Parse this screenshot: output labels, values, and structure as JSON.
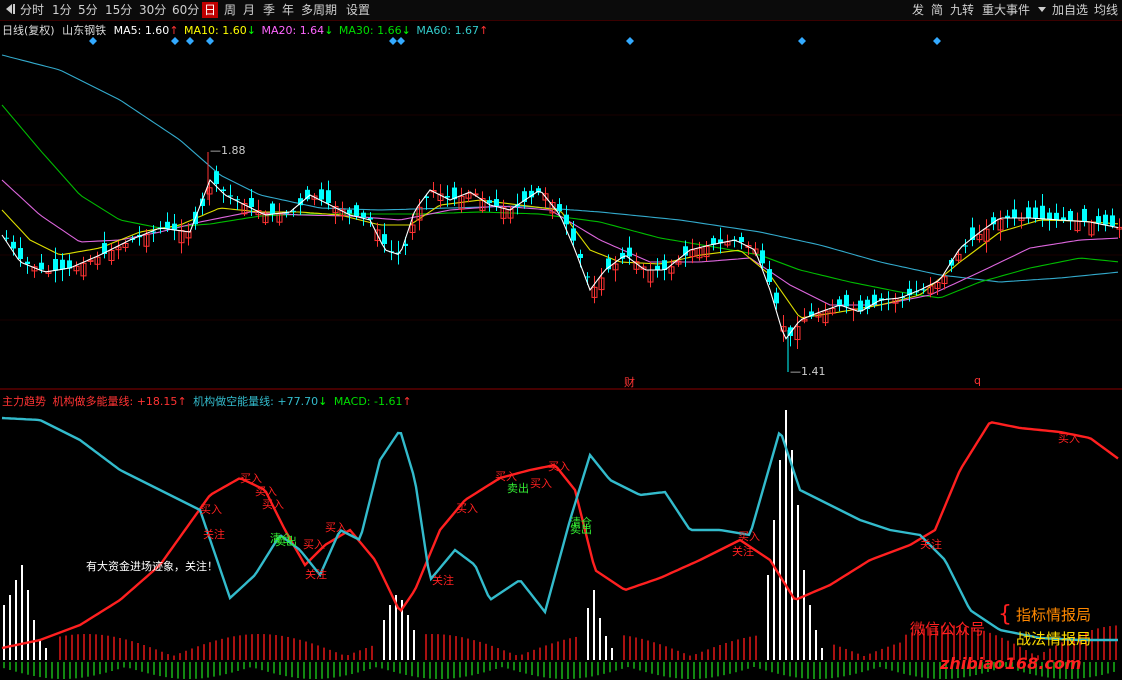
{
  "toolbar": {
    "back_icon": "back-arrow-icon",
    "periods": [
      "分时",
      "1分",
      "5分",
      "15分",
      "30分",
      "60分",
      "日",
      "周",
      "月",
      "季",
      "年",
      "多周期",
      "设置"
    ],
    "active_period": "日",
    "right_buttons": [
      "发",
      "简",
      "九转",
      "重大事件",
      "加自选",
      "均线"
    ]
  },
  "price_panel": {
    "chart_label": "日线(复权)",
    "stock_name": "山东钢铁",
    "ma": [
      {
        "name": "MA5",
        "value": "1.60",
        "arrow": "↑",
        "color": "#ffffff"
      },
      {
        "name": "MA10",
        "value": "1.60",
        "arrow": "↓",
        "color": "#ffff00"
      },
      {
        "name": "MA20",
        "value": "1.64",
        "arrow": "↓",
        "color": "#ff66ff"
      },
      {
        "name": "MA30",
        "value": "1.66",
        "arrow": "↓",
        "color": "#00dd00"
      },
      {
        "name": "MA60",
        "value": "1.67",
        "arrow": "↑",
        "color": "#33cccc"
      }
    ],
    "high_label": "1.88",
    "low_label": "1.41",
    "marker_cai": "财",
    "marker_q": "q"
  },
  "indicator_panel": {
    "name": "主力趋势",
    "long_label": "机构做多能量线:",
    "long_value": "+18.15",
    "long_arrow": "↑",
    "short_label": "机构做空能量线:",
    "short_value": "+77.70",
    "short_arrow": "↓",
    "macd_label": "MACD:",
    "macd_value": "-1.61",
    "macd_arrow": "↑",
    "note": "有大资金进场迹象，关注！",
    "signals": {
      "buy": "买入",
      "watch": "关注",
      "sell": "卖出",
      "clear": "清仓"
    }
  },
  "watermark": {
    "left_text": "微信公众号",
    "lines": [
      "指标情报局",
      "战法情报局"
    ],
    "url": "zhibiao168.com"
  },
  "colors": {
    "long_line": "#ff2020",
    "short_line": "#33bbcc",
    "up": "#ff3333",
    "down": "#00ffff",
    "accent": "#c00000"
  }
}
